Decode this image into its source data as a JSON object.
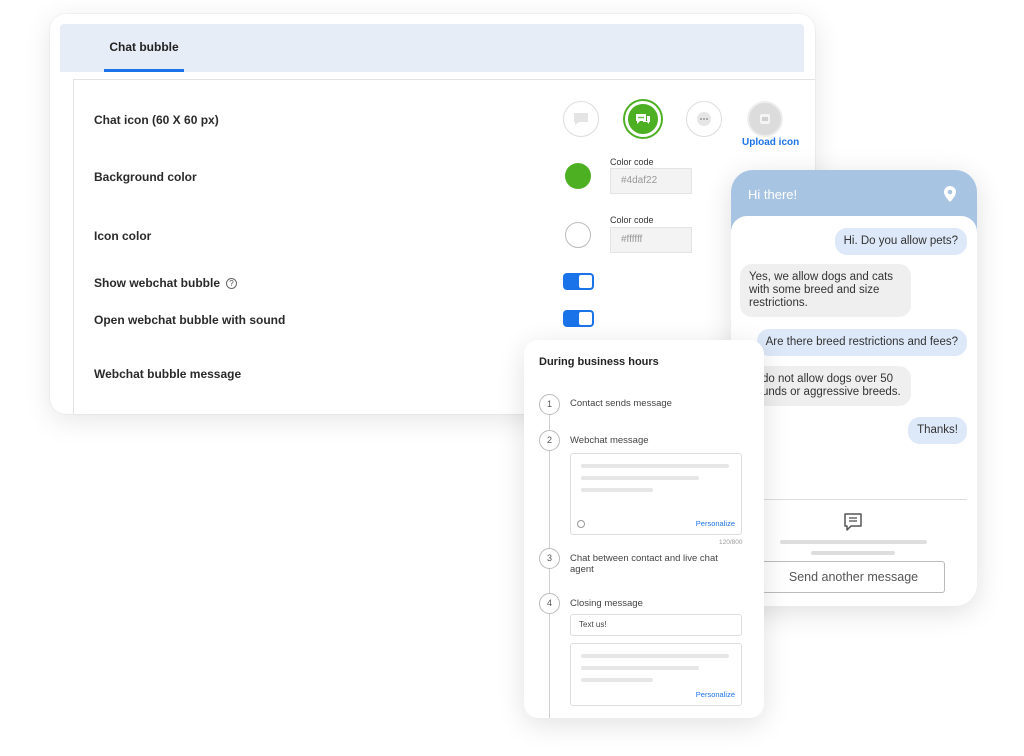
{
  "settings": {
    "tab_label": "Chat bubble",
    "rows": {
      "chat_icon_label": "Chat icon (60 X 60 px)",
      "background_color_label": "Background color",
      "icon_color_label": "Icon color",
      "show_bubble_label": "Show webchat bubble",
      "sound_label": "Open webchat bubble with sound",
      "bubble_message_label": "Webchat bubble message"
    },
    "icon_options": [
      "chat-bubble-light-icon",
      "chat-bubbles-icon",
      "ellipsis-bubble-icon",
      "upload-placeholder-icon"
    ],
    "selected_icon": "chat-bubbles-icon",
    "upload_label": "Upload icon",
    "help_glyph": "?",
    "background_color": {
      "code_label": "Color code",
      "value": "#4daf22",
      "swatch": "#4daf22"
    },
    "icon_color": {
      "code_label": "Color code",
      "value": "#ffffff",
      "swatch": "#ffffff"
    },
    "show_bubble_on": true,
    "sound_on": true,
    "accent_color": "#1a73e8"
  },
  "flow": {
    "title": "During business hours",
    "steps": [
      {
        "num": "1",
        "label": "Contact sends message"
      },
      {
        "num": "2",
        "label": "Webchat message"
      },
      {
        "num": "3",
        "label": "Chat between contact and live chat agent"
      },
      {
        "num": "4",
        "label": "Closing message"
      }
    ],
    "personalize_label": "Personalize",
    "char_count": "120/800",
    "closing_input": "Text us!"
  },
  "chat": {
    "header_title": "Hi there!",
    "header_color": "#a8c4e3",
    "messages": [
      {
        "from": "contact",
        "text": "Hi. Do you allow pets?"
      },
      {
        "from": "agent",
        "text": "Yes, we allow dogs and cats with some breed and size restrictions."
      },
      {
        "from": "contact",
        "text": "Are there breed restrictions and fees?"
      },
      {
        "from": "agent",
        "text": "do not allow dogs over 50 unds or aggressive breeds."
      },
      {
        "from": "contact",
        "text": "Thanks!"
      }
    ],
    "send_another_label": "Send another message"
  }
}
